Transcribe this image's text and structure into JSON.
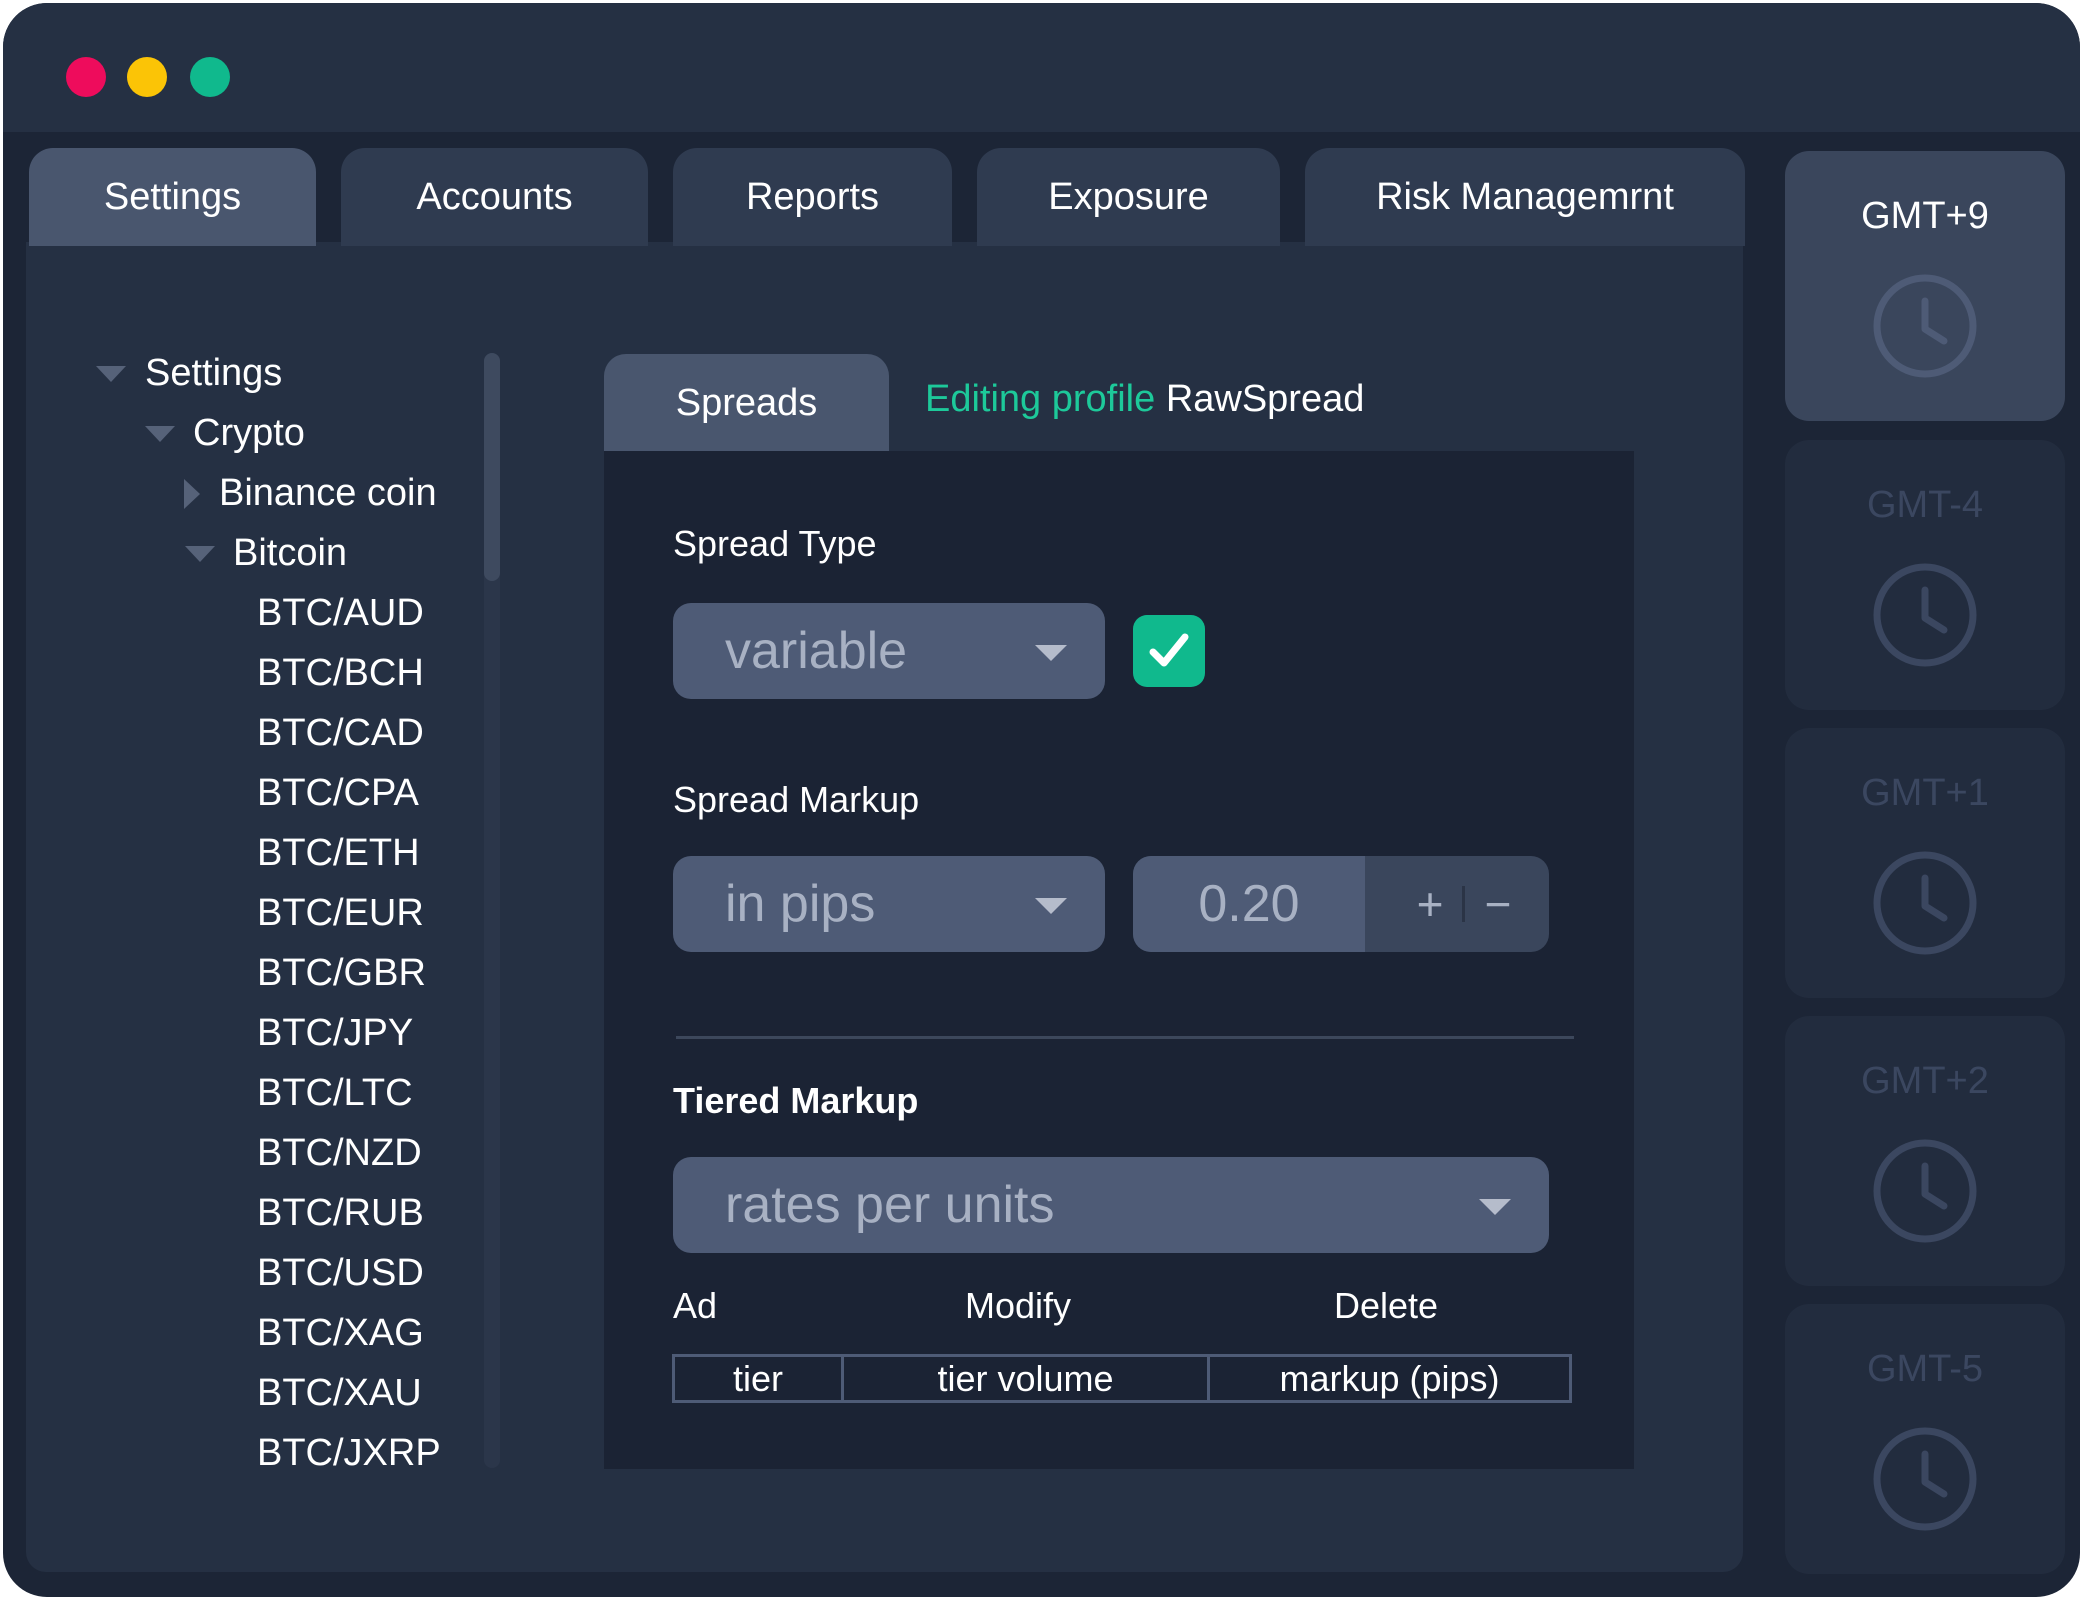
{
  "tabs": [
    {
      "label": "Settings",
      "active": true
    },
    {
      "label": "Accounts",
      "active": false
    },
    {
      "label": "Reports",
      "active": false
    },
    {
      "label": "Exposure",
      "active": false
    },
    {
      "label": "Risk Managemrnt",
      "active": false
    }
  ],
  "tree": {
    "root": "Settings",
    "group": "Crypto",
    "collapsed_item": "Binance coin",
    "expanded_item": "Bitcoin",
    "pairs": [
      "BTC/AUD",
      "BTC/BCH",
      "BTC/CAD",
      "BTC/CPA",
      "BTC/ETH",
      "BTC/EUR",
      "BTC/GBR",
      "BTC/JPY",
      "BTC/LTC",
      "BTC/NZD",
      "BTC/RUB",
      "BTC/USD",
      "BTC/XAG",
      "BTC/XAU",
      "BTC/JXRP"
    ]
  },
  "editor": {
    "tab_label": "Spreads",
    "editing_prefix": "Editing profile",
    "profile_name": "RawSpread",
    "spread_type_label": "Spread Type",
    "spread_type_value": "variable",
    "spread_type_checked": true,
    "spread_markup_label": "Spread Markup",
    "spread_markup_unit": "in pips",
    "spread_markup_value": "0.20",
    "plus": "+",
    "minus": "−",
    "tiered_markup_label": "Tiered Markup",
    "tiered_markup_value": "rates per units",
    "actions": {
      "add": "Ad",
      "modify": "Modify",
      "delete": "Delete"
    },
    "table_headers": [
      "tier",
      "tier volume",
      "markup (pips)"
    ]
  },
  "timezones": [
    {
      "label": "GMT+9",
      "active": true
    },
    {
      "label": "GMT-4",
      "active": false
    },
    {
      "label": "GMT+1",
      "active": false
    },
    {
      "label": "GMT+2",
      "active": false
    },
    {
      "label": "GMT-5",
      "active": false
    }
  ],
  "colors": {
    "background": "#1c2536",
    "panel": "#253043",
    "accent_green": "#10b98d",
    "editing_text": "#1dc99a",
    "traffic_red": "#ee0c5c",
    "traffic_yellow": "#fbc406",
    "traffic_green": "#10b98d"
  }
}
